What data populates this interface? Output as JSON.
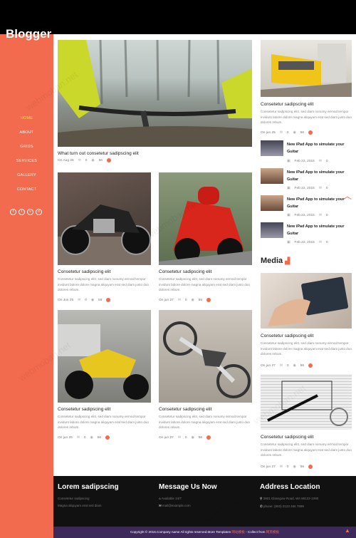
{
  "site": {
    "logo": "Blogger"
  },
  "nav": [
    "HOME",
    "ABOUT",
    "GRIDS",
    "SERVICES",
    "GALLERY",
    "CONTACT"
  ],
  "social": [
    "f",
    "t",
    "v",
    "d"
  ],
  "posts": [
    {
      "title": "What turn out consetetur sadipscing elit",
      "text": "",
      "date": "On Aug 25",
      "comments": "0",
      "views": "56"
    },
    {
      "title": "Consetetur sadipscing elit",
      "text": "Consetetur sadipscing elitr, sed diam nonumy eirmod tempor invidunt labore dolore magna aliquyam erat sed diam justo duo dolores rebum.",
      "date": "On Jun 25",
      "comments": "0",
      "views": "56"
    },
    {
      "title": "Consetetur sadipscing elit",
      "text": "Consetetur sadipscing elitr, sed diam nonumy eirmod tempor invidunt labore dolore magna aliquyam erat sed diam justo duo dolores rebum.",
      "date": "On jun 27",
      "comments": "0",
      "views": "56"
    },
    {
      "title": "Consetetur sadipscing elit",
      "text": "Consetetur sadipscing elitr, sed diam nonumy eirmod tempor invidunt labore dolore magna aliquyam erat sed diam justo duo dolores rebum.",
      "date": "On jun 25",
      "comments": "0",
      "views": "56"
    },
    {
      "title": "Consetetur sadipscing elit",
      "text": "Consetetur sadipscing elitr, sed diam nonumy eirmod tempor invidunt labore dolore magna aliquyam erat sed diam justo duo dolores rebum.",
      "date": "On jun 27",
      "comments": "0",
      "views": "56"
    }
  ],
  "sidebar": {
    "top_post": {
      "title": "Consetetur sadipscing elit",
      "text": "Consetetur sadipscing elitr, sed diam nonumy eirmod tempor invidunt labore dolore magna aliquyam erat sed diam justo duo dolores rebum.",
      "date": "On jun 25",
      "comments": "0",
      "views": "56"
    },
    "small_posts": [
      {
        "title": "New iPad App to simulate your Guitar",
        "date": "Feb 22, 2015",
        "comments": "0"
      },
      {
        "title": "New iPad App to simulate your Guitar",
        "date": "Feb 22, 2015",
        "comments": "0"
      },
      {
        "title": "New iPad App to simulate your Guitar",
        "date": "Feb 22, 2015",
        "comments": "0"
      },
      {
        "title": "New iPad App to simulate your Guitar",
        "date": "Feb 22, 2015",
        "comments": "0"
      }
    ],
    "media_heading": "Media",
    "media_posts": [
      {
        "title": "Consetetur sadipscing elit",
        "text": "Consetetur sadipscing elitr, sed diam nonumy eirmod tempor invidunt labore dolore magna aliquyam erat sed diam justo duo dolores rebum.",
        "date": "On jun 27",
        "comments": "0",
        "views": "56"
      },
      {
        "title": "Consetetur sadipscing elit",
        "text": "Consetetur sadipscing elitr, sed diam nonumy eirmod tempor invidunt labore dolore magna aliquyam erat sed diam justo duo dolores rebum.",
        "date": "On jun 27",
        "comments": "0",
        "views": "56"
      }
    ]
  },
  "footer": {
    "col1": {
      "heading": "Lorem sadipscing",
      "lines": [
        "Consetetur sadipscing",
        "Magna aliquyam erat sed diam"
      ]
    },
    "col2": {
      "heading": "Message Us Now",
      "lines": [
        "Available 24/7",
        "mail@example.com"
      ]
    },
    "col3": {
      "heading": "Address Location",
      "lines": [
        "2901 Glassgow Road, WA 98122-1090",
        "phone: (800) 0123 456 7899"
      ]
    },
    "copyright": "Copyright © 2016.Company name All rights reserved.More Templates",
    "link1": "网站模板",
    "collect": "- Collect from",
    "link2": "网页模板"
  },
  "watermark": "webmoban.net"
}
